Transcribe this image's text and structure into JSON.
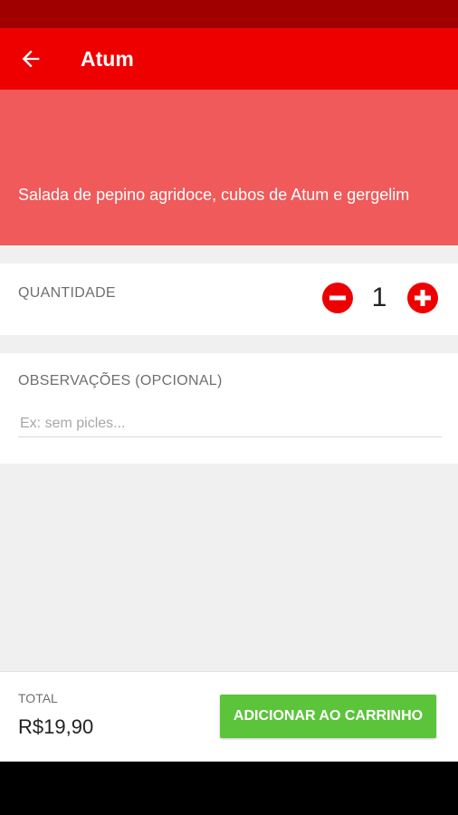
{
  "colors": {
    "status_bar": "#a00000",
    "app_bar": "#ee0000",
    "hero": "#f05a5a",
    "stepper_red": "#ee0000",
    "add_button_green": "#5cc43b"
  },
  "header": {
    "title": "Atum",
    "back_icon": "arrow-back-icon"
  },
  "product": {
    "description": "Salada de pepino agridoce, cubos de Atum e gergelim"
  },
  "quantity": {
    "label": "QUANTIDADE",
    "value": "1",
    "minus_icon": "minus-circle-icon",
    "plus_icon": "plus-circle-icon"
  },
  "notes": {
    "label": "OBSERVAÇÕES (OPCIONAL)",
    "placeholder": "Ex: sem picles...",
    "value": ""
  },
  "footer": {
    "total_label": "TOTAL",
    "total_value": "R$19,90",
    "add_button_label": "ADICIONAR AO CARRINHO"
  }
}
